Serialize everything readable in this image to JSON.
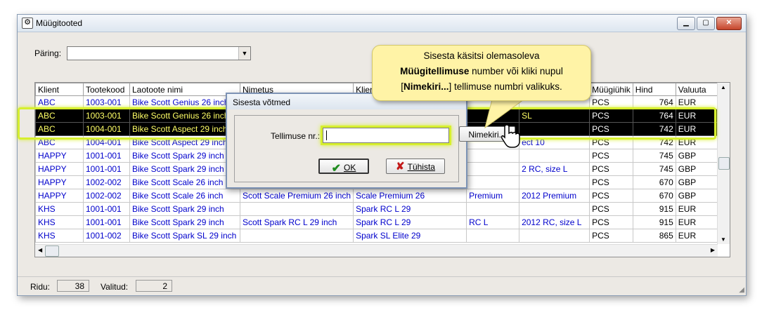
{
  "window": {
    "title": "Müügitooted"
  },
  "query": {
    "label": "Päring:",
    "value": ""
  },
  "grid": {
    "columns": [
      "Klient",
      "Tootekood",
      "Laotoote nimi",
      "Nimetus",
      "Klient",
      "",
      "",
      "Müügiühik",
      "Hind",
      "Valuuta"
    ],
    "rows": [
      {
        "selected": false,
        "cells": [
          "ABC",
          "1003-001",
          "Bike Scott Genius 26 inch",
          "",
          "",
          "",
          "",
          "PCS",
          "764",
          "EUR"
        ]
      },
      {
        "selected": true,
        "cells": [
          "ABC",
          "1003-001",
          "Bike Scott Genius 26 inch",
          "",
          "",
          "",
          "SL",
          "PCS",
          "764",
          "EUR"
        ]
      },
      {
        "selected": true,
        "cells": [
          "ABC",
          "1004-001",
          "Bike Scott Aspect 29 inch",
          "",
          "",
          "",
          "",
          "PCS",
          "742",
          "EUR"
        ]
      },
      {
        "selected": false,
        "cells": [
          "ABC",
          "1004-001",
          "Bike Scott Aspect 29 inch",
          "",
          "",
          "",
          "ect 10",
          "PCS",
          "742",
          "EUR"
        ]
      },
      {
        "selected": false,
        "cells": [
          "HAPPY",
          "1001-001",
          "Bike Scott Spark 29 inch",
          "",
          "",
          "",
          "",
          "PCS",
          "745",
          "GBP"
        ]
      },
      {
        "selected": false,
        "cells": [
          "HAPPY",
          "1001-001",
          "Bike Scott Spark 29 inch",
          "",
          "",
          "",
          "2 RC, size L",
          "PCS",
          "745",
          "GBP"
        ]
      },
      {
        "selected": false,
        "cells": [
          "HAPPY",
          "1002-002",
          "Bike Scott Scale 26 inch",
          "",
          "",
          "",
          "",
          "PCS",
          "670",
          "GBP"
        ]
      },
      {
        "selected": false,
        "cells": [
          "HAPPY",
          "1002-002",
          "Bike Scott Scale 26 inch",
          "Scott Scale Premium 26 inch",
          "Scale Premium 26",
          "Premium",
          "2012 Premium",
          "PCS",
          "670",
          "GBP"
        ]
      },
      {
        "selected": false,
        "cells": [
          "KHS",
          "1001-001",
          "Bike Scott Spark 29 inch",
          "",
          "Spark RC L 29",
          "",
          "",
          "PCS",
          "915",
          "EUR"
        ]
      },
      {
        "selected": false,
        "cells": [
          "KHS",
          "1001-001",
          "Bike Scott Spark 29 inch",
          "Scott Spark RC L 29 inch",
          "Spark RC L 29",
          "RC L",
          "2012 RC, size L",
          "PCS",
          "915",
          "EUR"
        ]
      },
      {
        "selected": false,
        "cells": [
          "KHS",
          "1001-002",
          "Bike Scott Spark SL 29 inch",
          "",
          "Spark SL Elite 29",
          "",
          "",
          "PCS",
          "865",
          "EUR"
        ]
      }
    ]
  },
  "status": {
    "rows_label": "Ridu:",
    "rows_value": "38",
    "selected_label": "Valitud:",
    "selected_value": "2"
  },
  "dialog": {
    "title": "Sisesta võtmed",
    "order_label": "Tellimuse nr.:",
    "order_value": "",
    "list_button": "Nimekiri...",
    "ok_button": "OK",
    "cancel_button": "Tühista"
  },
  "callout": {
    "line1": "Sisesta käsitsi olemasoleva",
    "line2_bold": "Müügitellimuse",
    "line2_rest": " number või kliki nupul",
    "line3_bracket_open": "[",
    "line3_bold": "Nimekiri...",
    "line3_rest": "] tellimuse numbri valikuks."
  },
  "colors": {
    "highlight": "#d7ef2e",
    "link_text": "#0000cc",
    "selected_text": "#ffff66",
    "callout_bg": "#fff3a6"
  }
}
